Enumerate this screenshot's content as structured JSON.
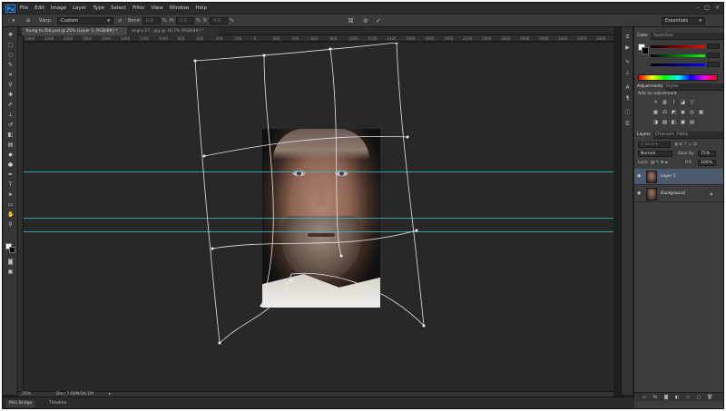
{
  "app": {
    "logo": "Ps",
    "menu": [
      "File",
      "Edit",
      "Image",
      "Layer",
      "Type",
      "Select",
      "Filter",
      "View",
      "Window",
      "Help"
    ],
    "window_controls": [
      "–",
      "□",
      "×"
    ]
  },
  "options_bar": {
    "warp_label": "Warp:",
    "warp_value": "Custom",
    "bend_label": "Bend:",
    "h_label": "H:",
    "v_label": "V:",
    "bend_value": "0.0",
    "h_value": "0.0",
    "v_value": "0.0",
    "pct": "%",
    "cancel_icon": "cancel-icon",
    "commit_icon": "commit-check-icon",
    "workspace": "Essentials"
  },
  "tabs": [
    {
      "label": "Young to Old.psd @ 25% (Layer 1, RGB/8#) *",
      "active": true
    },
    {
      "label": "angry-27...jpg @ 16.7% (RGB/8#) *",
      "active": false
    }
  ],
  "ruler": {
    "labels": [
      "2400",
      "2200",
      "2000",
      "1800",
      "1600",
      "1400",
      "1200",
      "1000",
      "800",
      "600",
      "400",
      "200",
      "0",
      "200",
      "400",
      "600",
      "800",
      "1000",
      "1200",
      "1400",
      "1600",
      "1800",
      "2000",
      "2200",
      "2400",
      "2600",
      "2800",
      "3000",
      "3200",
      "3400",
      "3600"
    ]
  },
  "status": {
    "zoom": "25%",
    "doc": "Doc: 7.00M/26.1M"
  },
  "bottom_tabs": [
    "Mini Bridge",
    "Timeline"
  ],
  "panels": {
    "color_tabs": [
      "Color",
      "Swatches"
    ],
    "adjustments_tabs": [
      "Adjustments",
      "Styles"
    ],
    "adjustments_hint": "Add an adjustment",
    "layers_tabs": [
      "Layers",
      "Channels",
      "Paths"
    ],
    "blend_mode": "Normal",
    "opacity_label": "Opacity:",
    "opacity_value": "75%",
    "lock_label": "Lock:",
    "fill_label": "Fill:",
    "fill_value": "100%",
    "layers": [
      {
        "name": "Layer 1",
        "selected": true
      },
      {
        "name": "Background",
        "selected": false,
        "locked": true
      }
    ]
  },
  "colors": {
    "accent_guide": "#3bb3c6",
    "selected_layer": "#4d5a6e"
  }
}
